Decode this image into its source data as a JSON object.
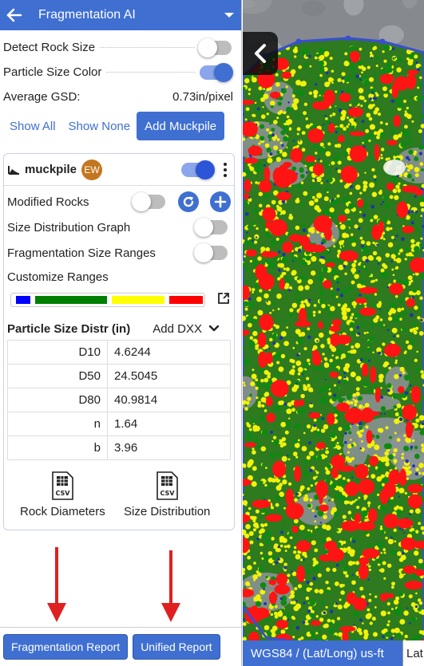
{
  "header": {
    "title": "Fragmentation AI"
  },
  "settings": {
    "detect_rock_size": {
      "label": "Detect Rock Size",
      "enabled": false
    },
    "particle_size_color": {
      "label": "Particle Size Color",
      "enabled": true
    },
    "average_gsd": {
      "label": "Average GSD:",
      "value": "0.73in/pixel"
    }
  },
  "actions": {
    "show_all": "Show All",
    "show_none": "Show None",
    "add_muckpile": "Add Muckpile"
  },
  "muckpile": {
    "name": "muckpile",
    "avatar_initials": "EW",
    "visible": true,
    "modified_rocks": {
      "label": "Modified Rocks",
      "enabled": false
    },
    "size_distribution_graph": {
      "label": "Size Distribution Graph",
      "enabled": false
    },
    "fragmentation_size_ranges": {
      "label": "Fragmentation Size Ranges",
      "enabled": false
    },
    "customize_ranges": {
      "label": "Customize Ranges",
      "colors": [
        "#0000ff",
        "#008000",
        "#ffff00",
        "#ff0000"
      ]
    },
    "psd": {
      "title": "Particle Size Distr (in)",
      "add_label": "Add DXX",
      "rows": [
        {
          "key": "D10",
          "value": "4.6244"
        },
        {
          "key": "D50",
          "value": "24.5045"
        },
        {
          "key": "D80",
          "value": "40.9814"
        },
        {
          "key": "n",
          "value": "1.64"
        },
        {
          "key": "b",
          "value": "3.96"
        }
      ]
    },
    "downloads": {
      "rock_diameters": "Rock Diameters",
      "size_distribution": "Size Distribution",
      "file_badge": "CSV"
    }
  },
  "footer": {
    "fragmentation_report": "Fragmentation Report",
    "unified_report": "Unified Report"
  },
  "map": {
    "crs": "WGS84 / (Lat/Long) us-ft",
    "coord_prefix": "Lat"
  },
  "colors": {
    "accent": "#3f6fd1",
    "annotation_arrow": "#e02020"
  }
}
